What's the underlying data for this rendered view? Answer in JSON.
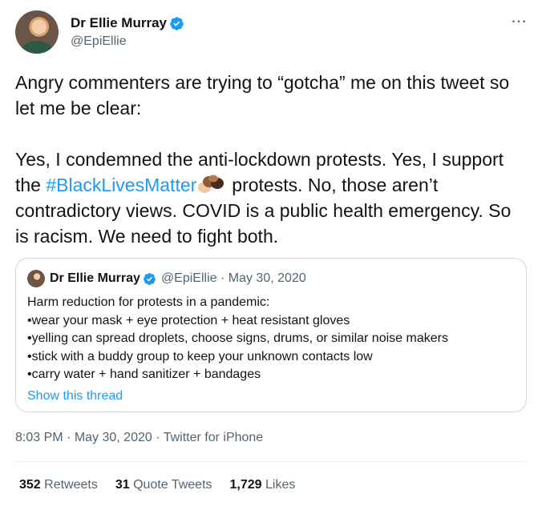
{
  "author": {
    "name": "Dr Ellie Murray",
    "handle": "@EpiEllie"
  },
  "more_icon": "more-horizontal-icon",
  "tweet": {
    "paragraph1": "Angry commenters are trying to “gotcha” me on this tweet so let me be clear:",
    "p2_before": "Yes, I condemned the anti-lockdown protests. Yes, I support the ",
    "hashtag": "#BlackLivesMatter",
    "p2_after": "protests. No, those aren’t contradictory views. COVID is a public health emergency. So is racism. We need to fight both."
  },
  "quoted": {
    "name": "Dr Ellie Murray",
    "handle_date": "@EpiEllie · May 30, 2020",
    "lines": [
      "Harm reduction for protests in a pandemic:",
      "•wear your mask + eye protection + heat resistant gloves",
      "•yelling can spread droplets, choose signs, drums, or similar noise makers",
      "•stick with a buddy group to keep your unknown contacts low",
      "•carry water + hand sanitizer + bandages"
    ],
    "show_thread": "Show this thread"
  },
  "meta": {
    "time": "8:03 PM",
    "date": "May 30, 2020",
    "source": "Twitter for iPhone",
    "separator": " · "
  },
  "stats": {
    "retweets_count": "352",
    "retweets_label": "Retweets",
    "quotes_count": "31",
    "quotes_label": "Quote Tweets",
    "likes_count": "1,729",
    "likes_label": "Likes"
  },
  "colors": {
    "link": "#1d9bf0",
    "secondary_text": "#536471",
    "verified": "#1d9bf0",
    "border": "#cfd9de"
  }
}
